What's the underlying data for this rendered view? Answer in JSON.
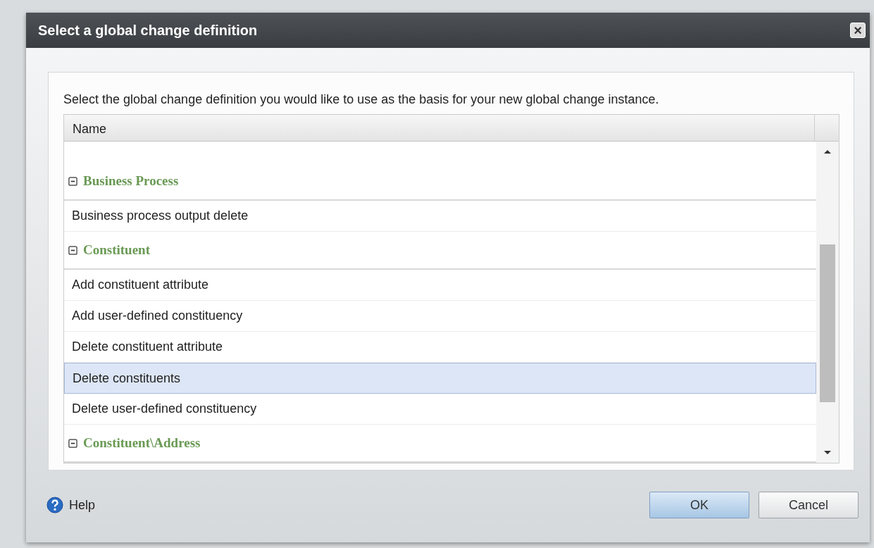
{
  "window": {
    "title": "Select a global change definition",
    "close": "×"
  },
  "instruction": "Select the global change definition you would like to use as the basis for your new global change instance.",
  "table": {
    "columns": [
      "Name"
    ],
    "rows": [
      {
        "kind": "group",
        "label": "Business Process",
        "expanded": true
      },
      {
        "kind": "item",
        "label": "Business process output delete",
        "selected": false
      },
      {
        "kind": "group",
        "label": "Constituent",
        "expanded": true
      },
      {
        "kind": "item",
        "label": "Add constituent attribute",
        "selected": false
      },
      {
        "kind": "item",
        "label": "Add user-defined constituency",
        "selected": false
      },
      {
        "kind": "item",
        "label": "Delete constituent attribute",
        "selected": false
      },
      {
        "kind": "item",
        "label": "Delete constituents",
        "selected": true
      },
      {
        "kind": "item",
        "label": "Delete user-defined constituency",
        "selected": false
      },
      {
        "kind": "group",
        "label": "Constituent\\Address",
        "expanded": true
      }
    ]
  },
  "help": {
    "label": "Help"
  },
  "buttons": [
    {
      "label": "OK",
      "primary": true
    },
    {
      "label": "Cancel",
      "primary": false
    }
  ]
}
